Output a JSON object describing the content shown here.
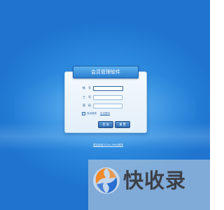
{
  "login": {
    "title": "会员管理软件",
    "fields": [
      {
        "label": "帐　号",
        "value": ""
      },
      {
        "label": "工　号",
        "value": ""
      },
      {
        "label": "密　码",
        "value": ""
      }
    ],
    "remember_label": "自动登录",
    "remember_extra": "忘记密码",
    "login_button": "登 录",
    "reset_button": "重 置",
    "footer_link": "建议使用1024×768分辨率"
  },
  "watermark": {
    "text": "快收录",
    "icon": "kuaishoulu-logo-icon",
    "colors": {
      "orange": "#f08a2b",
      "blue": "#2a6fd0",
      "text": "#3b3f46"
    }
  },
  "colors": {
    "background": "#2f8ee0",
    "panel": "#eef5fb",
    "ribbon": "#3a8ad8",
    "button": "#3c79bf"
  }
}
